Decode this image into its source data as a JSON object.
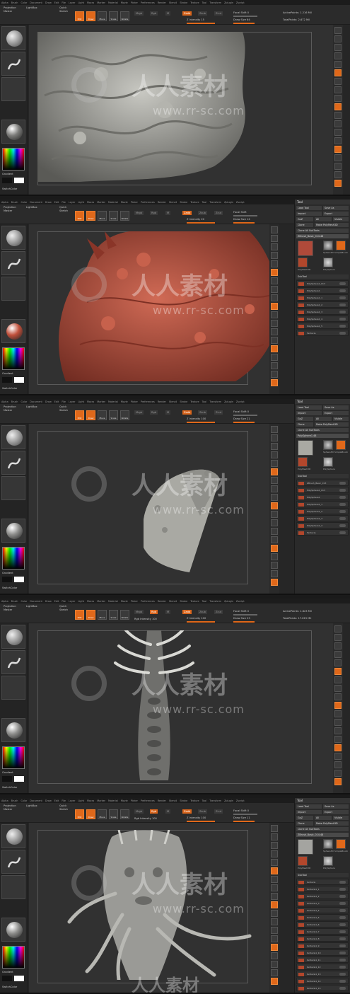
{
  "menu": [
    "Alpha",
    "Brush",
    "Color",
    "Document",
    "Draw",
    "Edit",
    "File",
    "Layer",
    "Light",
    "Macro",
    "Marker",
    "Material",
    "Movie",
    "Picker",
    "Preferences",
    "Render",
    "Stencil",
    "Stroke",
    "Texture",
    "Tool",
    "Transform",
    "Zplugin",
    "Zscript"
  ],
  "shelf": {
    "projection_master": "Projection Master",
    "lightbox": "LightBox",
    "quick_sketch": "Quick Sketch",
    "edit": "Edit",
    "draw": "Draw",
    "move": "Move",
    "scale": "Scale",
    "rotate": "Rotate",
    "mrgb": "Mrgb",
    "rgb": "Rgb",
    "m": "M",
    "zadd": "Zadd",
    "zsub": "Zsub",
    "zcut": "Zcut",
    "focal_shift_label": "Focal Shift",
    "draw_size_label": "Draw Size",
    "z_intensity_label": "Z Intensity",
    "rgb_intensity_label": "Rgb Intensity",
    "active_points_label": "ActivePoints:",
    "total_points_label": "TotalPoints:"
  },
  "left": {
    "gradient": "Gradient",
    "switch_color": "SwitchColor"
  },
  "tool_panel": {
    "title": "Tool",
    "load_tool": "Load Tool",
    "save_as": "Save As",
    "import": "Import",
    "export": "Export",
    "goz": "GoZ",
    "all": "All",
    "visible": "Visible",
    "clone": "Clone",
    "make_polymesh": "Make PolyMesh3D",
    "clone_all": "Clone All SubTools",
    "subtool": "SubTool",
    "sphere3d": "Sphere3D",
    "simplebrush": "SimpleBrush",
    "polymesh3d": "PolyMesh3D",
    "polysphere": "PolySphere"
  },
  "panels": [
    {
      "id": "p1",
      "z_intensity": "15",
      "draw_size": "64",
      "focal_shift": "0",
      "active_points": "1.216 Mil",
      "total_points": "2.672 Mil",
      "model_color": "#9b9b95",
      "has_tool_panel": false
    },
    {
      "id": "p2",
      "z_intensity": "20",
      "draw_size": "14",
      "focal_shift": "",
      "active_points": "",
      "total_points": "",
      "model_color": "#b04a3a",
      "has_tool_panel": true,
      "current_tool": "ZBrush_Basic_014.48",
      "subtools": [
        "PolySphere1_013",
        "PolySphere1",
        "PolySphere1_1",
        "PolySphere1_2",
        "PolySphere1_3",
        "PolySphere1_4",
        "PolySphere1_5",
        "Tentacle"
      ]
    },
    {
      "id": "p3",
      "z_intensity": "100",
      "draw_size": "21",
      "focal_shift": "0",
      "active_points": "",
      "total_points": "",
      "model_color": "#a9a9a3",
      "has_tool_panel": true,
      "current_tool": "PolySphere1.48",
      "subtools": [
        "ZBrush_Basic_013",
        "PolySphere1_013",
        "PolySphere1",
        "PolySphere1_1",
        "PolySphere1_2",
        "PolySphere1_3",
        "PolySphere1_4",
        "Tentacle"
      ]
    },
    {
      "id": "p4",
      "z_intensity": "100",
      "draw_size": "23",
      "focal_shift": "0",
      "rgb_intensity": "100",
      "active_points": "1.823 Mil",
      "total_points": "17.615 Mil",
      "model_color": "#8e8e8a",
      "has_tool_panel": false
    },
    {
      "id": "p5",
      "z_intensity": "100",
      "draw_size": "11",
      "focal_shift": "0",
      "rgb_intensity": "100",
      "active_points": "",
      "total_points": "",
      "model_color": "#a4a4a0",
      "has_tool_panel": true,
      "current_tool": "ZBrush_Basic_014.48",
      "subtools": [
        "tentacle",
        "tentacle1_1",
        "tentacle1_2",
        "tentacle1_3",
        "tentacle1_4",
        "tentacle1_5",
        "tentacle1_6",
        "tentacle1_7",
        "tentacle1_8",
        "tentacle1_9",
        "tentacle1_10",
        "tentacle1_11",
        "tentacle1_12",
        "tentacle1_13",
        "tentacle1_14",
        "tentacle1_15"
      ]
    }
  ],
  "watermark": {
    "brand": "人人素材",
    "url": "www.rr-sc.com"
  },
  "colors": {
    "accent": "#e0681a",
    "ui_bg": "#262626",
    "viewport_bg": "#313131"
  }
}
